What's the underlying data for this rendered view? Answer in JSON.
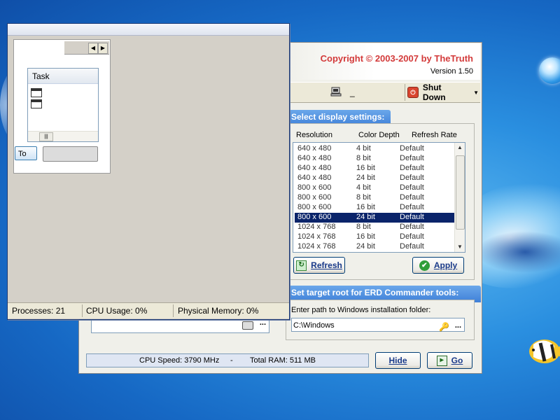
{
  "erd": {
    "copyright": "Copyright © 2003-2007 by TheTruth",
    "version": "Version 1.50",
    "toolbar": {
      "computer_label": "_",
      "shutdown_label": "Shut Down"
    },
    "display": {
      "title": "Select display settings:",
      "columns": [
        "Resolution",
        "Color Depth",
        "Refresh Rate"
      ],
      "rows": [
        {
          "res": "640 x 480",
          "depth": "4 bit",
          "rate": "Default"
        },
        {
          "res": "640 x 480",
          "depth": "8 bit",
          "rate": "Default"
        },
        {
          "res": "640 x 480",
          "depth": "16 bit",
          "rate": "Default"
        },
        {
          "res": "640 x 480",
          "depth": "24 bit",
          "rate": "Default"
        },
        {
          "res": "800 x 600",
          "depth": "4 bit",
          "rate": "Default"
        },
        {
          "res": "800 x 600",
          "depth": "8 bit",
          "rate": "Default"
        },
        {
          "res": "800 x 600",
          "depth": "16 bit",
          "rate": "Default"
        },
        {
          "res": "800 x 600",
          "depth": "24 bit",
          "rate": "Default"
        },
        {
          "res": "1024 x 768",
          "depth": "8 bit",
          "rate": "Default"
        },
        {
          "res": "1024 x 768",
          "depth": "16 bit",
          "rate": "Default"
        },
        {
          "res": "1024 x 768",
          "depth": "24 bit",
          "rate": "Default"
        }
      ],
      "selected_index": 7,
      "refresh_label": "Refresh",
      "apply_label": "Apply"
    },
    "root": {
      "title": "Set target root for ERD Commander tools:",
      "prompt": "Enter path to Windows installation folder:",
      "path_value": "C:\\Windows",
      "browse_label": "..."
    },
    "left_browse_label": "...",
    "status": {
      "cpu_speed": "CPU Speed: 3790 MHz",
      "separator": "-",
      "total_ram": "Total RAM: 511 MB"
    },
    "hide_label": "Hide",
    "go_label": "Go"
  },
  "taskmgr": {
    "task_header": "Task",
    "to_label": "To",
    "status": {
      "processes": "Processes: 21",
      "cpu": "CPU Usage: 0%",
      "memory": "Physical Memory: 0%"
    }
  },
  "colors": {
    "accent_title": "#3f80d8",
    "selection": "#0a246a",
    "copyright_red": "#d33a3a"
  }
}
